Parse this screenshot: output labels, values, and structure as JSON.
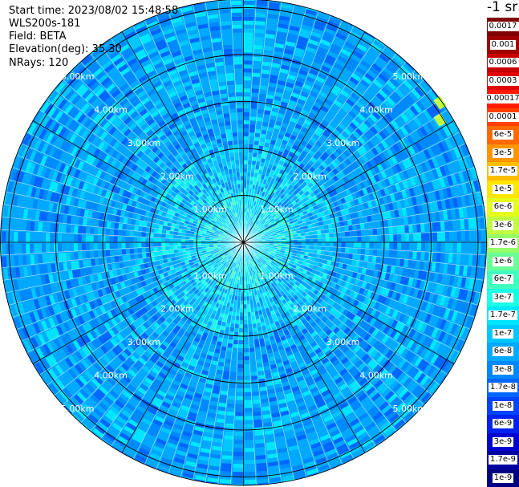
{
  "header": {
    "start_time": "Start time: 2023/08/02 15:48:58",
    "station": "WLS200s-181",
    "field": "Field: BETA",
    "elevation": "Elevation(deg): 35.30",
    "nrays": "NRays: 120"
  },
  "colorbar": {
    "unit_label": "-1 sr",
    "levels": [
      {
        "label": "0.0017",
        "color": "#800000"
      },
      {
        "label": "0.001",
        "color": "#a00000"
      },
      {
        "label": "0.0006",
        "color": "#c80000"
      },
      {
        "label": "0.0003",
        "color": "#e00000"
      },
      {
        "label": "0.00017",
        "color": "#ff1a00"
      },
      {
        "label": "0.0001",
        "color": "#ff4000"
      },
      {
        "label": "6e-5",
        "color": "#ff6a00"
      },
      {
        "label": "3e-5",
        "color": "#ff9400"
      },
      {
        "label": "1.7e-5",
        "color": "#ffbf00"
      },
      {
        "label": "1e-5",
        "color": "#ffe600"
      },
      {
        "label": "6e-6",
        "color": "#e6ff1a"
      },
      {
        "label": "3e-6",
        "color": "#bfff40"
      },
      {
        "label": "1.7e-6",
        "color": "#94ff6a"
      },
      {
        "label": "1e-6",
        "color": "#6aff94"
      },
      {
        "label": "6e-7",
        "color": "#40ffbf"
      },
      {
        "label": "3e-7",
        "color": "#1affe6"
      },
      {
        "label": "1.7e-7",
        "color": "#00e6ff"
      },
      {
        "label": "1e-7",
        "color": "#00c8ff"
      },
      {
        "label": "6e-8",
        "color": "#00a8ff"
      },
      {
        "label": "3e-8",
        "color": "#0088ff"
      },
      {
        "label": "1.7e-8",
        "color": "#0066ff"
      },
      {
        "label": "1e-8",
        "color": "#0044ff"
      },
      {
        "label": "6e-9",
        "color": "#0022f0"
      },
      {
        "label": "3e-9",
        "color": "#0000d0"
      },
      {
        "label": "1.7e-9",
        "color": "#0000a0"
      },
      {
        "label": "1e-9",
        "color": "#000080"
      }
    ]
  },
  "chart_data": {
    "type": "heatmap",
    "projection": "polar-ppi",
    "field": "BETA",
    "elevation_deg": 35.3,
    "n_rays": 120,
    "max_range_km": 5.2,
    "rings_km": [
      1,
      2,
      3,
      4,
      5
    ],
    "ring_labels": {
      "1": "1.00km",
      "2": "2.00km",
      "3": "3.00km",
      "4": "4.00km",
      "5": "5.00km"
    },
    "spokes_deg_step": 30,
    "typical_values": {
      "inner_0_to_1km": "1e-7 to 3e-7",
      "mid_1_to_2km": "6e-8 to 1.7e-7",
      "outer_2_to_5km": "1.7e-8 to 1e-7",
      "isolated_max_near_5km": "3e-6"
    }
  }
}
